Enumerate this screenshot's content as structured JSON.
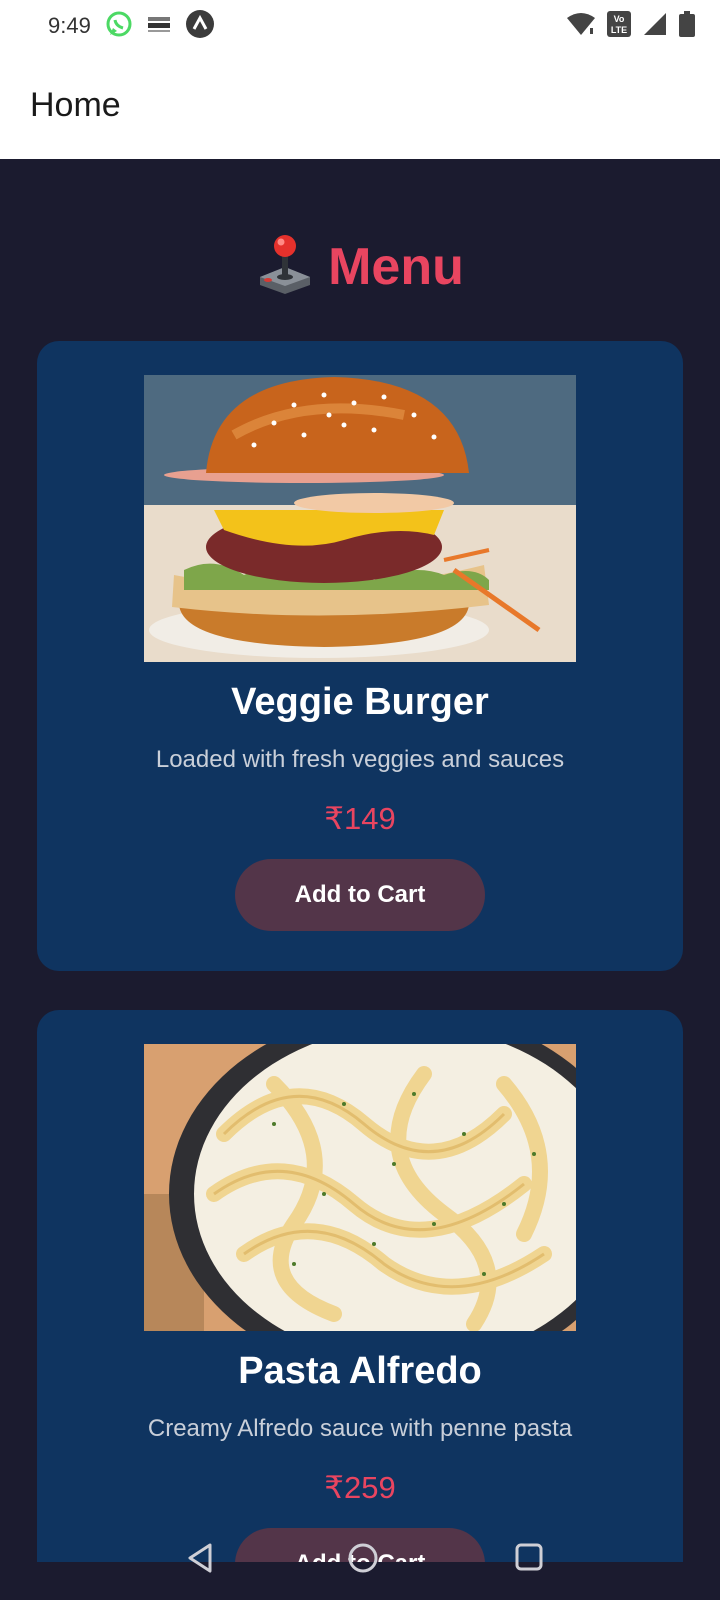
{
  "status_bar": {
    "time": "9:49",
    "notification_icons": [
      "whatsapp-icon",
      "miracle-brand-icon",
      "app-launcher-icon"
    ],
    "system_icons": [
      "wifi-icon",
      "volte-icon",
      "signal-icon",
      "battery-icon"
    ],
    "volte_text": "Vo LTE"
  },
  "app_bar": {
    "title": "Home"
  },
  "menu": {
    "heading_icon": "joystick-icon",
    "heading": "Menu"
  },
  "items": [
    {
      "name": "Veggie Burger",
      "description": "Loaded with fresh veggies and sauces",
      "price": "₹149",
      "button_label": "Add to Cart",
      "image": "burger-photo"
    },
    {
      "name": "Pasta Alfredo",
      "description": "Creamy Alfredo sauce with penne pasta",
      "price": "₹259",
      "button_label": "Add to Cart",
      "image": "pasta-photo"
    }
  ],
  "nav_bar": {
    "icons": [
      "back-icon",
      "home-icon",
      "recents-icon"
    ]
  },
  "colors": {
    "background": "#1b1b2f",
    "card": "#0f3460",
    "accent": "#e94560",
    "button": "#533549"
  }
}
